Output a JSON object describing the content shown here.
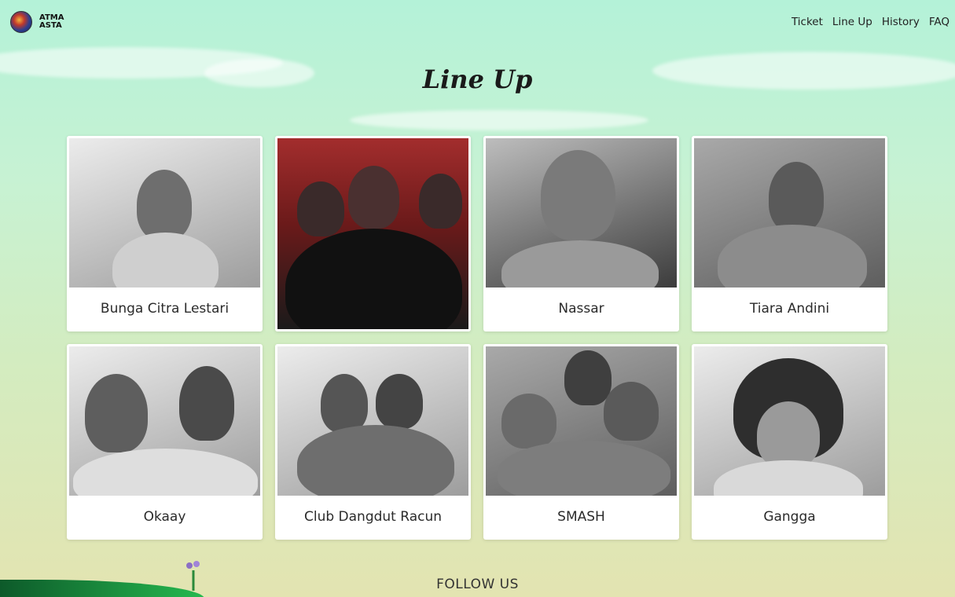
{
  "brand": {
    "line1": "ATMA",
    "line2": "ASTA"
  },
  "nav": {
    "items": [
      {
        "label": "Ticket"
      },
      {
        "label": "Line Up"
      },
      {
        "label": "History"
      },
      {
        "label": "FAQ"
      }
    ]
  },
  "page": {
    "title": "Line Up"
  },
  "lineup": [
    {
      "name": "Bunga Citra Lestari"
    },
    {
      "name": ""
    },
    {
      "name": "Nassar"
    },
    {
      "name": "Tiara Andini"
    },
    {
      "name": "Okaay"
    },
    {
      "name": "Club Dangdut Racun"
    },
    {
      "name": "SMASH"
    },
    {
      "name": "Gangga"
    }
  ],
  "footer": {
    "follow_label": "FOLLOW US"
  },
  "colors": {
    "background_top": "#b4f2d8",
    "background_bottom": "#e3e4b1",
    "card": "#ffffff",
    "text": "#2b2b2b"
  }
}
